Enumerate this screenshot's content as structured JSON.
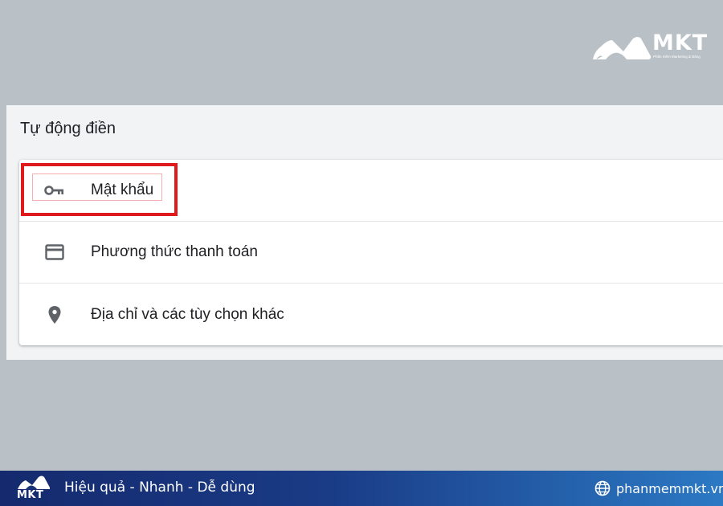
{
  "brand": {
    "name": "MKT",
    "tagline": "Phần mềm Marketing & Bảng",
    "logo_color": "#ffffff"
  },
  "autofill": {
    "title": "Tự động điền",
    "items": [
      {
        "label": "Mật khẩu",
        "icon": "key-icon",
        "highlighted": true
      },
      {
        "label": "Phương thức thanh toán",
        "icon": "credit-card-icon",
        "highlighted": false
      },
      {
        "label": "Địa chỉ và các tùy chọn khác",
        "icon": "location-pin-icon",
        "highlighted": false
      }
    ],
    "highlight_color": "#e0191d"
  },
  "footer": {
    "logo_text": "MKT",
    "slogan": "Hiệu quả - Nhanh - Dễ dùng",
    "website": "phanmemmkt.vn",
    "website_icon": "globe-icon"
  }
}
